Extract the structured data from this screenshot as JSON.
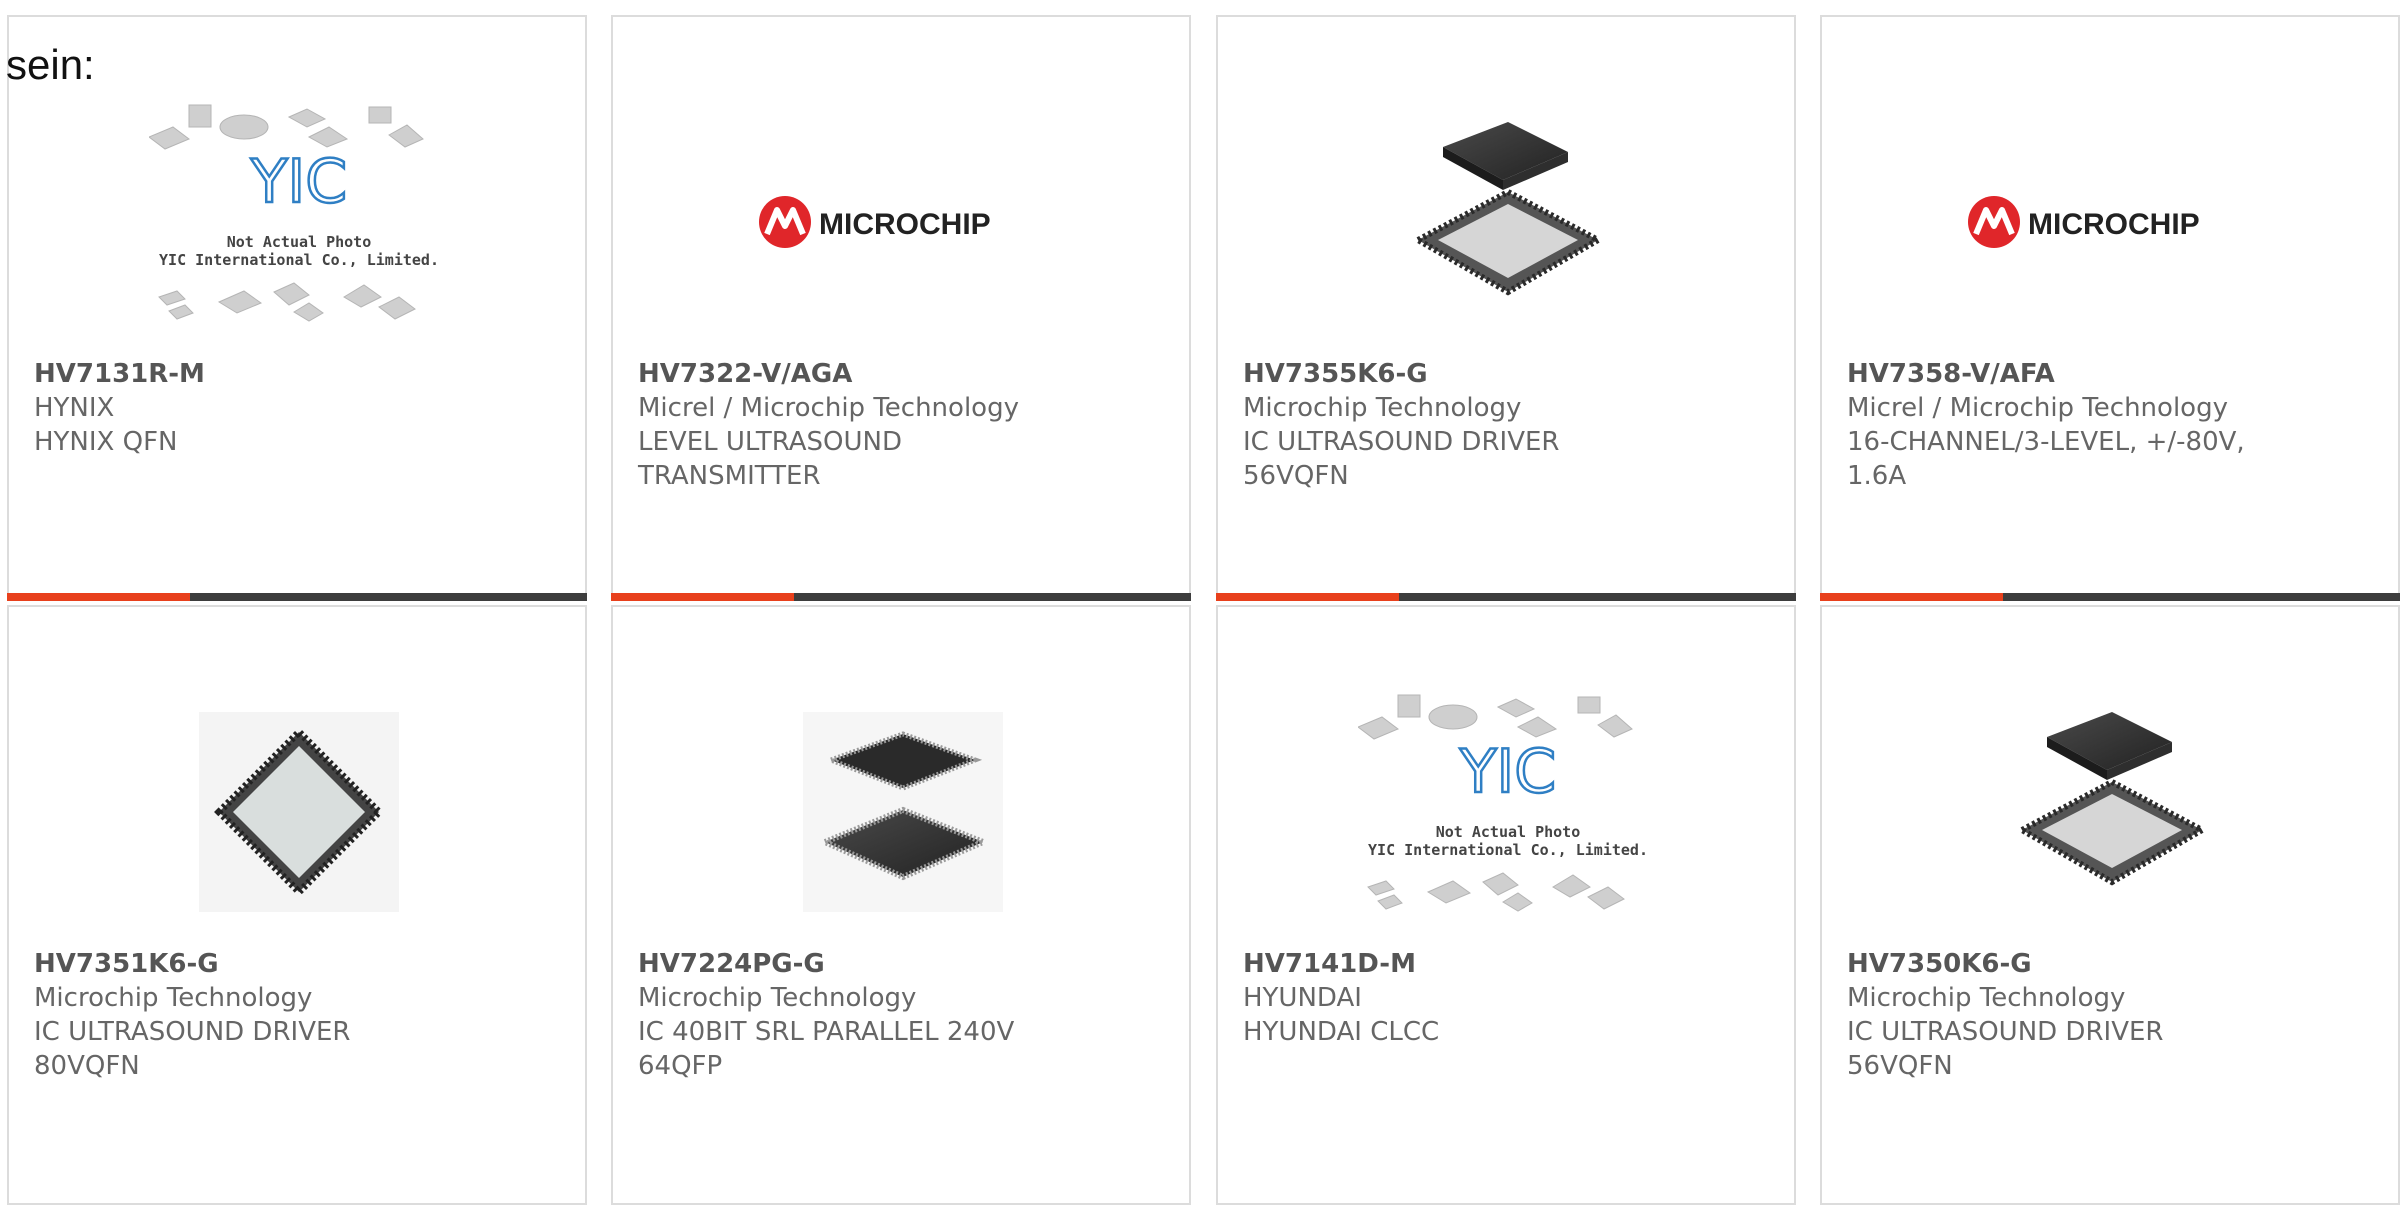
{
  "intro_text": "sein:",
  "colors": {
    "accent": "#e8401c",
    "bar": "#3d3d3d",
    "text": "#666666",
    "brand_red": "#e0262a"
  },
  "products": [
    {
      "part": "HV7131R-M",
      "maker": "HYNIX",
      "desc": "HYNIX QFN",
      "image": "not-actual-photo-placeholder",
      "placeholder_line1": "Not Actual Photo",
      "placeholder_line2": "YIC International Co., Limited.",
      "placeholder_logo": "YIC"
    },
    {
      "part": "HV7322-V/AGA",
      "maker": "Micrel / Microchip Technology",
      "desc": "LEVEL ULTRASOUND TRANSMITTER",
      "image": "microchip-logo",
      "logo_text": "MICROCHIP"
    },
    {
      "part": "HV7355K6-G",
      "maker": "Microchip Technology",
      "desc": "IC ULTRASOUND DRIVER 56VQFN",
      "image": "qfn-chip-photo"
    },
    {
      "part": "HV7358-V/AFA",
      "maker": "Micrel / Microchip Technology",
      "desc": "16-CHANNEL/3-LEVEL, +/-80V, 1.6A",
      "image": "microchip-logo",
      "logo_text": "MICROCHIP"
    },
    {
      "part": "HV7351K6-G",
      "maker": "Microchip Technology",
      "desc": "IC ULTRASOUND DRIVER 80VQFN",
      "image": "qfn-chip-single-photo"
    },
    {
      "part": "HV7224PG-G",
      "maker": "Microchip Technology",
      "desc": "IC 40BIT SRL PARALLEL 240V 64QFP",
      "image": "qfp-chip-photo"
    },
    {
      "part": "HV7141D-M",
      "maker": "HYUNDAI",
      "desc": "HYUNDAI CLCC",
      "image": "not-actual-photo-placeholder",
      "placeholder_line1": "Not Actual Photo",
      "placeholder_line2": "YIC International Co., Limited.",
      "placeholder_logo": "YIC"
    },
    {
      "part": "HV7350K6-G",
      "maker": "Microchip Technology",
      "desc": "IC ULTRASOUND DRIVER 56VQFN",
      "image": "qfn-chip-photo"
    }
  ]
}
